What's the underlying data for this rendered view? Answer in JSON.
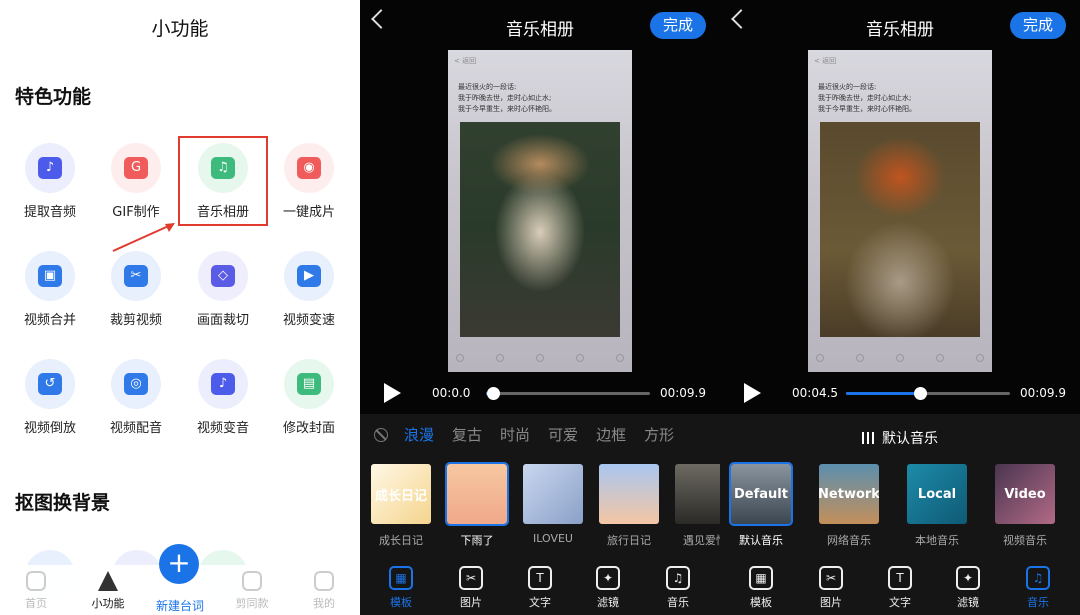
{
  "panel1": {
    "title": "小功能",
    "sections": {
      "featured": "特色功能",
      "cutout": "抠图换背景"
    },
    "tools": [
      {
        "label": "提取音频",
        "color": "#4d5bea",
        "bg": "#eceefe",
        "glyph": "♪"
      },
      {
        "label": "GIF制作",
        "color": "#f05c5c",
        "bg": "#feeded",
        "glyph": "G"
      },
      {
        "label": "音乐相册",
        "color": "#3dba7c",
        "bg": "#e6f7ee",
        "glyph": "♫"
      },
      {
        "label": "一键成片",
        "color": "#f05c5c",
        "bg": "#feeded",
        "glyph": "◉"
      },
      {
        "label": "视频合并",
        "color": "#2f7ae8",
        "bg": "#e8f0fd",
        "glyph": "▣"
      },
      {
        "label": "裁剪视频",
        "color": "#2f7ae8",
        "bg": "#e8f0fd",
        "glyph": "✂"
      },
      {
        "label": "画面裁切",
        "color": "#5b5ce6",
        "bg": "#eeeefd",
        "glyph": "◇"
      },
      {
        "label": "视频变速",
        "color": "#2f7ae8",
        "bg": "#e8f0fd",
        "glyph": "▶"
      },
      {
        "label": "视频倒放",
        "color": "#2f7ae8",
        "bg": "#e8f0fd",
        "glyph": "↺"
      },
      {
        "label": "视频配音",
        "color": "#2f7ae8",
        "bg": "#e8f0fd",
        "glyph": "◎"
      },
      {
        "label": "视频变音",
        "color": "#4d5bea",
        "bg": "#eceefe",
        "glyph": "♪"
      },
      {
        "label": "修改封面",
        "color": "#3dba7c",
        "bg": "#e6f7ee",
        "glyph": "▤"
      }
    ],
    "nav": [
      {
        "label": "首页",
        "active": false
      },
      {
        "label": "小功能",
        "active": true
      },
      {
        "label": "新建台词",
        "active": false
      },
      {
        "label": "剪同款",
        "active": false
      },
      {
        "label": "我的",
        "active": false
      }
    ],
    "fab": "+"
  },
  "editor_left": {
    "title": "音乐相册",
    "done": "完成",
    "preview_top": "< 返回",
    "preview_text": "最近很火的一段话:\n我于昨晚去世，走时心如止水;\n我于今早重生，来时心怀艳阳。",
    "time_current": "00:0.0",
    "time_total": "00:09.9",
    "progress": 0.04,
    "template_tabs": [
      "浪漫",
      "复古",
      "时尚",
      "可爱",
      "边框",
      "方形"
    ],
    "active_tab": "浪漫",
    "templates": [
      {
        "label": "成长日记",
        "selected": false,
        "overlay": "成长日记",
        "bg": "linear-gradient(135deg,#fff8e6,#f5d48c)"
      },
      {
        "label": "下雨了",
        "selected": true,
        "overlay": "",
        "bg": "linear-gradient(180deg,#f6c8a2,#f0a88a)"
      },
      {
        "label": "ILOVEU",
        "selected": false,
        "overlay": "",
        "bg": "linear-gradient(135deg,#c9d7ef,#8aa0c8)"
      },
      {
        "label": "旅行日记",
        "selected": false,
        "overlay": "",
        "bg": "linear-gradient(180deg,#a9c6f0,#f4c6a4)"
      },
      {
        "label": "遇见爱情",
        "selected": false,
        "overlay": "",
        "bg": "linear-gradient(180deg,#6d6a62,#2b2a27)"
      }
    ],
    "toolbar": [
      {
        "label": "模板",
        "active": true,
        "glyph": "▦"
      },
      {
        "label": "图片",
        "active": false,
        "glyph": "✂"
      },
      {
        "label": "文字",
        "active": false,
        "glyph": "T"
      },
      {
        "label": "滤镜",
        "active": false,
        "glyph": "✦"
      },
      {
        "label": "音乐",
        "active": false,
        "glyph": "♫"
      }
    ]
  },
  "editor_right": {
    "title": "音乐相册",
    "done": "完成",
    "preview_top": "< 返回",
    "preview_text": "最近很火的一段话:\n我于昨晚去世，走时心如止水;\n我于今早重生，来时心怀艳阳。",
    "time_current": "00:04.5",
    "time_total": "00:09.9",
    "progress": 0.45,
    "music_head": "默认音乐",
    "music": [
      {
        "label": "默认音乐",
        "selected": true,
        "overlay": "Default",
        "bg": "linear-gradient(180deg,#8a949e,#3c4650)"
      },
      {
        "label": "网络音乐",
        "selected": false,
        "overlay": "Network",
        "bg": "linear-gradient(180deg,#5b8fae,#c48f5a)"
      },
      {
        "label": "本地音乐",
        "selected": false,
        "overlay": "Local",
        "bg": "linear-gradient(135deg,#1d8ba8,#0f5a75)"
      },
      {
        "label": "视频音乐",
        "selected": false,
        "overlay": "Video",
        "bg": "linear-gradient(135deg,#4a3550,#b26a86)"
      }
    ],
    "toolbar": [
      {
        "label": "模板",
        "active": false,
        "glyph": "▦"
      },
      {
        "label": "图片",
        "active": false,
        "glyph": "✂"
      },
      {
        "label": "文字",
        "active": false,
        "glyph": "T"
      },
      {
        "label": "滤镜",
        "active": false,
        "glyph": "✦"
      },
      {
        "label": "音乐",
        "active": true,
        "glyph": "♫"
      }
    ]
  }
}
